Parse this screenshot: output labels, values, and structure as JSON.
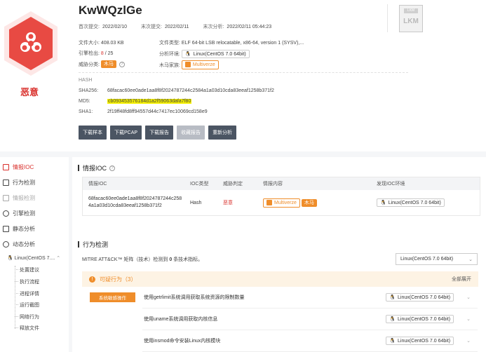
{
  "header": {
    "title": "KwWQzlGe",
    "verdict": "恶意",
    "dates": [
      {
        "label": "首次提交:",
        "value": "2022/02/10"
      },
      {
        "label": "末次提交:",
        "value": "2022/02/11"
      },
      {
        "label": "末次分析:",
        "value": "2022/02/11 05:44:23"
      }
    ],
    "file_size_label": "文件大小:",
    "file_size": "408.03 KB",
    "file_type_label": "文件类型:",
    "file_type": "ELF 64-bit LSB relocatable, x86-64, version 1 (SYSV),...",
    "engine_label": "引擎检出:",
    "engine_hits": "8",
    "engine_total": "/ 25",
    "env_label": "分析环境:",
    "env": "Linux(CentOS 7.0 64bit)",
    "threat_label": "威胁分类:",
    "threat": "木马",
    "family_label": "木马家族:",
    "family": "Multiverze",
    "help": "?",
    "hash_title": "HASH",
    "sha256_label": "SHA256:",
    "sha256": "68facac60ee0ade1aa8f8f2024787244c2584a1a03d10cda83eeaf1258b371f2",
    "md5_label": "MD5:",
    "md5": "cb093453576184d1a2f59063dafa7f80",
    "sha1_label": "SHA1:",
    "sha1": "2f19ff48fd8ff94557d44c7417ec10069cd158e9",
    "buttons": [
      "下载样本",
      "下载PCAP",
      "下载报告",
      "收藏报告",
      "重新分析"
    ],
    "lkm_top": "LKM",
    "lkm_name": "LKM"
  },
  "sidebar": {
    "items": [
      {
        "label": "情报IOC"
      },
      {
        "label": "行为检测"
      },
      {
        "label": "情报检测"
      },
      {
        "label": "引擎检测"
      },
      {
        "label": "静态分析"
      },
      {
        "label": "动态分析"
      }
    ],
    "env_item": "Linux(CentOS 7....",
    "sub_items": [
      "处置建议",
      "执行流程",
      "进程详情",
      "运行截图",
      "网络行为",
      "释放文件"
    ]
  },
  "ioc": {
    "title": "情报IOC",
    "help": "?",
    "columns": [
      "情报IOC",
      "IOC类型",
      "威胁判定",
      "情报内容",
      "发现IOC环境"
    ],
    "row": {
      "ioc_line1": "68facac60ee0ade1aa8f8f2024787244c258",
      "ioc_line2": "4a1a03d10cda83eeaf1258b371f2",
      "type": "Hash",
      "verdict": "恶意",
      "family": "Multiverze",
      "threat": "木马",
      "env": "Linux(CentOS 7.0 64bit)"
    }
  },
  "behavior": {
    "title": "行为检测",
    "mitre_prefix": "MITRE ATT&CK™ 矩阵（技术）检测到",
    "mitre_count": "0",
    "mitre_suffix": "条技术指标。",
    "env_select": "Linux(CentOS 7.0 64bit)",
    "suspicious_label": "可疑行为（3）",
    "expand_all": "全部展开",
    "category": "系统敏感操作",
    "rows": [
      {
        "text": "使用getrlimit系统调用获取系统资源的限制数量",
        "env": "Linux(CentOS 7.0 64bit)"
      },
      {
        "text": "使用uname系统调用获取内核信息",
        "env": "Linux(CentOS 7.0 64bit)"
      },
      {
        "text": "使用insmod命令安装Linux内核模块",
        "env": "Linux(CentOS 7.0 64bit)"
      }
    ]
  },
  "colors": {
    "accent_red": "#d9302c",
    "warning_orange": "#ef8d2a",
    "highlight": "#f5f000"
  }
}
